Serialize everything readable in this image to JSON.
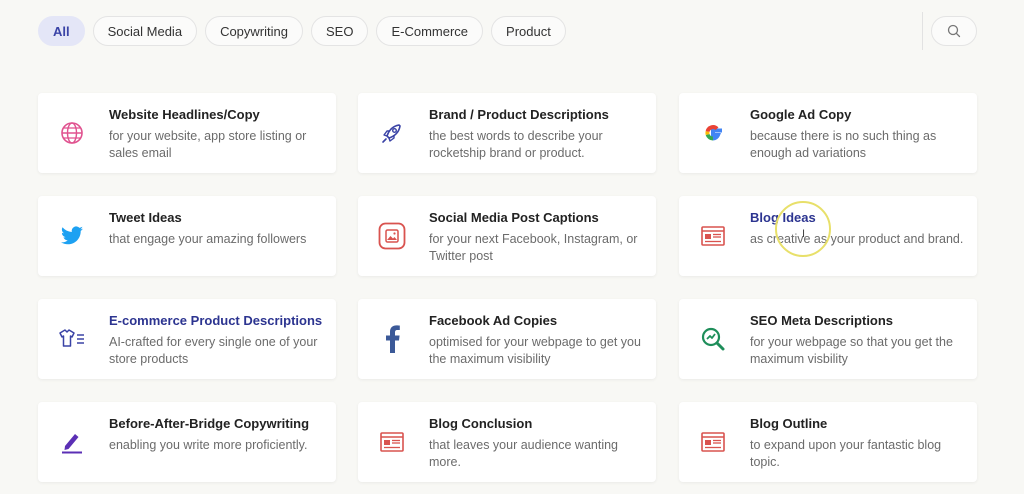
{
  "filters": [
    "All",
    "Social Media",
    "Copywriting",
    "SEO",
    "E-Commerce",
    "Product"
  ],
  "active_filter": "All",
  "cards": [
    {
      "title": "Website Headlines/Copy",
      "desc": "for your website, app store listing or sales email",
      "icon": "globe-icon"
    },
    {
      "title": "Brand / Product Descriptions",
      "desc": "the best words to describe your rocketship brand or product.",
      "icon": "rocket-icon"
    },
    {
      "title": "Google Ad Copy",
      "desc": "because there is no such thing as enough ad variations",
      "icon": "google-icon"
    },
    {
      "title": "Tweet Ideas",
      "desc": "that engage your amazing followers",
      "icon": "twitter-icon"
    },
    {
      "title": "Social Media Post Captions",
      "desc": "for your next Facebook, Instagram, or Twitter post",
      "icon": "image-icon"
    },
    {
      "title": "Blog Ideas",
      "desc": "as creative as your product and brand.",
      "icon": "article-icon"
    },
    {
      "title": "E-commerce Product Descriptions",
      "desc": "AI-crafted for every single one of your store products",
      "icon": "tshirt-icon"
    },
    {
      "title": "Facebook Ad Copies",
      "desc": "optimised for your webpage to get you the maximum visibility",
      "icon": "facebook-icon"
    },
    {
      "title": "SEO Meta Descriptions",
      "desc": "for your webpage so that you get the maximum visbility",
      "icon": "seo-search-icon"
    },
    {
      "title": "Before-After-Bridge Copywriting",
      "desc": "enabling you write more proficiently.",
      "icon": "pen-icon"
    },
    {
      "title": "Blog Conclusion",
      "desc": "that leaves your audience wanting more.",
      "icon": "article-icon"
    },
    {
      "title": "Blog Outline",
      "desc": "to expand upon your fantastic blog topic.",
      "icon": "article-icon"
    }
  ],
  "colors": {
    "accent": "#3a43a6",
    "active_chip_bg": "#e4e6f7",
    "icon_red": "#d9534f",
    "twitter": "#1da1f2",
    "facebook": "#3b5998",
    "seo_green": "#1e8e5a",
    "pen_purple": "#5b2fb5",
    "globe_pink": "#e0528f"
  }
}
